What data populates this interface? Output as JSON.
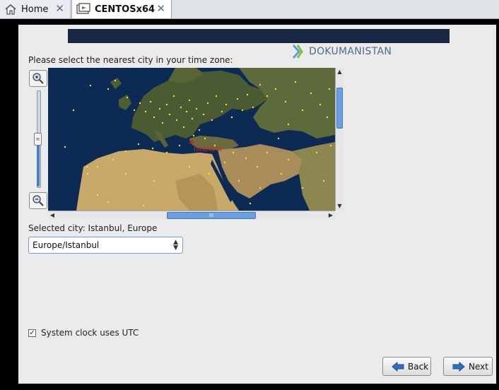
{
  "tabs": [
    {
      "label": "Home",
      "icon": "home-icon"
    },
    {
      "label": "CENTOSx64",
      "icon": "vm-icon"
    }
  ],
  "watermark": "DOKUMANISTAN",
  "installer": {
    "prompt": "Please select the nearest city in your time zone:",
    "map": {
      "marker_city": "Istanbul",
      "zoom_level": 0.45
    },
    "selected_city_text": "Selected city: Istanbul, Europe",
    "timezone_select": {
      "value": "Europe/Istanbul"
    },
    "utc_checkbox": {
      "label": "System clock uses UTC",
      "checked": true
    },
    "buttons": {
      "back": "Back",
      "next": "Next"
    }
  },
  "colors": {
    "header": "#1a2744",
    "scroll_thumb": "#6b9fe0",
    "marker": "#d11f1f",
    "city_dot": "#f2e22a"
  }
}
